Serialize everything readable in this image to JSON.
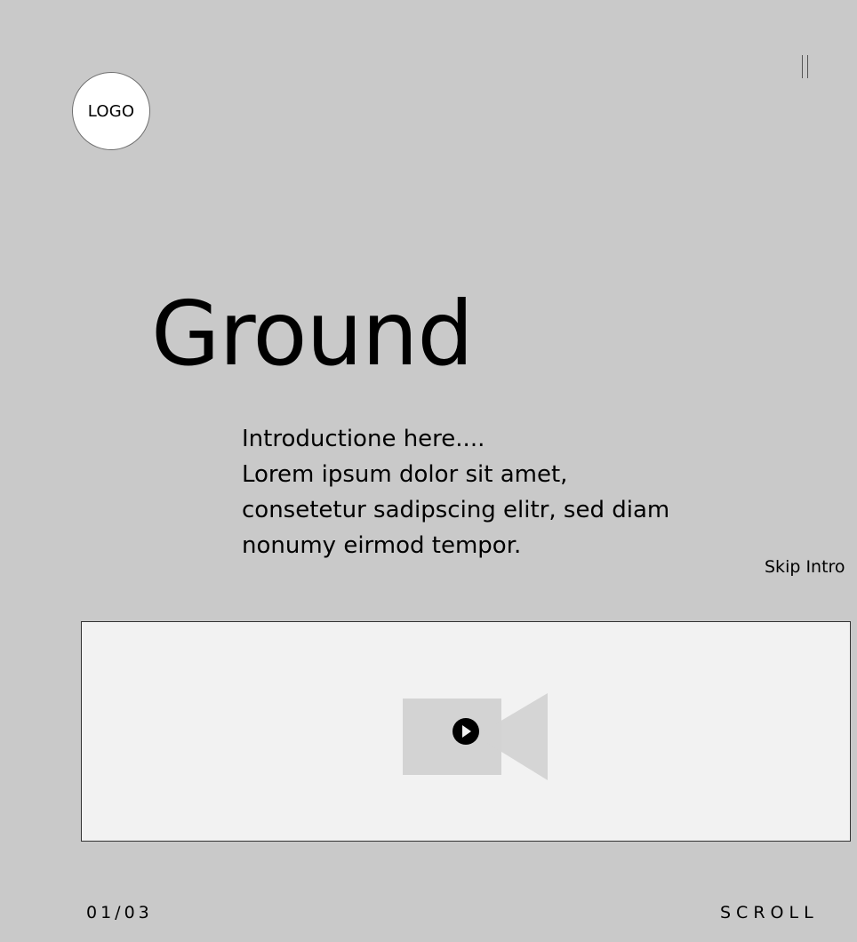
{
  "logo": {
    "label": "LOGO"
  },
  "menu": {
    "icon": "pause-icon"
  },
  "hero": {
    "title": "Ground",
    "intro_lines": [
      "Introductione here....",
      "Lorem ipsum dolor sit amet,",
      "consetetur sadipscing elitr, sed diam",
      "nonumy eirmod tempor."
    ]
  },
  "skip_intro": {
    "label": "Skip Intro"
  },
  "video": {
    "icon": "video-camera-icon",
    "play_icon": "play-icon"
  },
  "footer": {
    "counter": "01/03",
    "scroll_label": "SCROLL"
  },
  "colors": {
    "background": "#c9c9c9",
    "video_panel": "#f2f2f2",
    "logo_fill": "#ffffff"
  }
}
